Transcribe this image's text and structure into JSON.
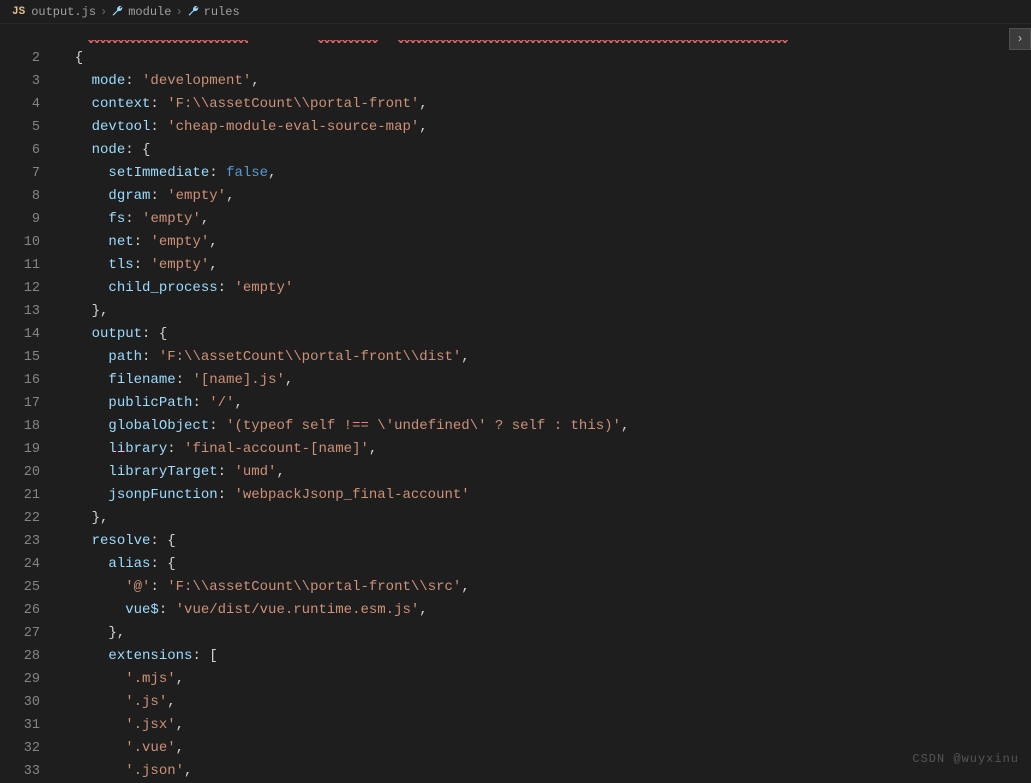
{
  "breadcrumb": {
    "file_icon": "JS",
    "file": "output.js",
    "sep": "›",
    "item1": "module",
    "item2": "rules"
  },
  "lines": {
    "start": 2,
    "end": 33
  },
  "code": {
    "l2": "{",
    "l3": {
      "key": "mode",
      "val": "'development'"
    },
    "l4": {
      "key": "context",
      "val": "'F:\\\\assetCount\\\\portal-front'"
    },
    "l5": {
      "key": "devtool",
      "val": "'cheap-module-eval-source-map'"
    },
    "l6": {
      "key": "node",
      "open": "{"
    },
    "l7": {
      "key": "setImmediate",
      "bool": "false"
    },
    "l8": {
      "key": "dgram",
      "val": "'empty'"
    },
    "l9": {
      "key": "fs",
      "val": "'empty'"
    },
    "l10": {
      "key": "net",
      "val": "'empty'"
    },
    "l11": {
      "key": "tls",
      "val": "'empty'"
    },
    "l12": {
      "key": "child_process",
      "val": "'empty'"
    },
    "l13": "},",
    "l14": {
      "key": "output",
      "open": "{"
    },
    "l15": {
      "key": "path",
      "val": "'F:\\\\assetCount\\\\portal-front\\\\dist'"
    },
    "l16": {
      "key": "filename",
      "val": "'[name].js'"
    },
    "l17": {
      "key": "publicPath",
      "val": "'/'"
    },
    "l18": {
      "key": "globalObject",
      "val": "'(typeof self !== \\'undefined\\' ? self : this)'"
    },
    "l19": {
      "key": "library",
      "val": "'final-account-[name]'"
    },
    "l20": {
      "key": "libraryTarget",
      "val": "'umd'"
    },
    "l21": {
      "key": "jsonpFunction",
      "val": "'webpackJsonp_final-account'"
    },
    "l22": "},",
    "l23": {
      "key": "resolve",
      "open": "{"
    },
    "l24": {
      "key": "alias",
      "open": "{"
    },
    "l25": {
      "key": "'@'",
      "val": "'F:\\\\assetCount\\\\portal-front\\\\src'",
      "keyIsString": true
    },
    "l26": {
      "key": "vue$",
      "val": "'vue/dist/vue.runtime.esm.js'"
    },
    "l27": "},",
    "l28": {
      "key": "extensions",
      "open": "["
    },
    "l29": {
      "arr": "'.mjs'"
    },
    "l30": {
      "arr": "'.js'"
    },
    "l31": {
      "arr": "'.jsx'"
    },
    "l32": {
      "arr": "'.vue'"
    },
    "l33": {
      "arr": "'.json'"
    }
  },
  "watermark": "CSDN @wuyxinu",
  "colon": ": ",
  "comma": ",",
  "sideArrow": "›"
}
